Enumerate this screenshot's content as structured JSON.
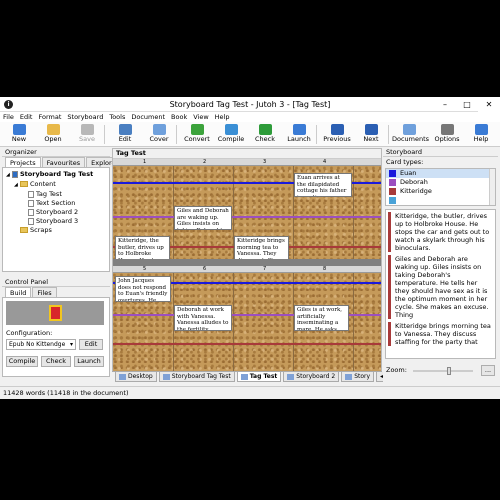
{
  "window": {
    "title": "Storyboard Tag Test - Jutoh 3 - [Tag Test]",
    "app_icon": "info-icon"
  },
  "menu": [
    "File",
    "Edit",
    "Format",
    "Storyboard",
    "Tools",
    "Document",
    "Book",
    "View",
    "Help"
  ],
  "toolbar": [
    {
      "label": "New",
      "icon": "new-document-icon",
      "color": "#3a7bd5",
      "enabled": true
    },
    {
      "label": "Open",
      "icon": "open-folder-icon",
      "color": "#e8b94a",
      "enabled": true
    },
    {
      "label": "Save",
      "icon": "floppy-disk-icon",
      "color": "#555555",
      "enabled": false
    },
    {
      "label": "Edit",
      "icon": "edit-icon",
      "color": "#4a7fc1",
      "enabled": true
    },
    {
      "label": "Cover",
      "icon": "cover-icon",
      "color": "#6fa0dc",
      "enabled": true
    },
    {
      "label": "Convert",
      "icon": "convert-icon",
      "color": "#3ca33c",
      "enabled": true
    },
    {
      "label": "Compile",
      "icon": "compile-icon",
      "color": "#3a8fd5",
      "enabled": true
    },
    {
      "label": "Check",
      "icon": "check-icon",
      "color": "#2e9c3a",
      "enabled": true
    },
    {
      "label": "Launch",
      "icon": "launch-icon",
      "color": "#3a7bd5",
      "enabled": true
    },
    {
      "label": "Previous",
      "icon": "previous-icon",
      "color": "#2b5fb3",
      "enabled": true
    },
    {
      "label": "Next",
      "icon": "next-icon",
      "color": "#2b5fb3",
      "enabled": true
    },
    {
      "label": "Documents",
      "icon": "documents-icon",
      "color": "#6fa0dc",
      "enabled": true
    },
    {
      "label": "Options",
      "icon": "options-icon",
      "color": "#777777",
      "enabled": true
    },
    {
      "label": "Help",
      "icon": "help-icon",
      "color": "#3a7bd5",
      "enabled": true
    }
  ],
  "organizer": {
    "title": "Organizer",
    "tabs": [
      "Projects",
      "Favourites",
      "Explorer"
    ],
    "tree": [
      {
        "label": "Storyboard Tag Test",
        "type": "root"
      },
      {
        "label": "Content",
        "type": "folder"
      },
      {
        "label": "Tag Test",
        "type": "doc"
      },
      {
        "label": "Text Section",
        "type": "doc"
      },
      {
        "label": "Storyboard 2",
        "type": "doc"
      },
      {
        "label": "Storyboard 3",
        "type": "doc"
      },
      {
        "label": "Scraps",
        "type": "folder"
      }
    ]
  },
  "control_panel": {
    "title": "Control Panel",
    "tabs": [
      "Build",
      "Files"
    ],
    "config_label": "Configuration:",
    "config_value": "Epub No Kittendge",
    "edit": "Edit",
    "compile": "Compile",
    "check": "Check",
    "launch": "Launch"
  },
  "storyboard": {
    "title": "Tag Test",
    "columns_top": [
      "1",
      "2",
      "3",
      "4"
    ],
    "columns_bottom": [
      "5",
      "6",
      "7",
      "8"
    ],
    "cards_top": [
      "Euan arrives at the dilapidated cottage his father is renting.",
      "Giles and Deborah are waking up. Giles insists on taking Deborah's",
      "Kitteridge, the butler, drives up to Holbroke House. He stops the car and gets out",
      "Kitteridge brings morning tea to Vanessa. They discuss staffing for the party."
    ],
    "cards_bottom": [
      "John Jacques does not respond to Euan's friendly overtures. He does let him come",
      "Deborah at work with Vanessa. Vanessa alludes to the fertility treatment - Deborah is",
      "Giles is at work, artificially inseminating a mare. He asks his"
    ]
  },
  "bottom_tabs": [
    "Desktop",
    "Storyboard Tag Test",
    "Tag Test",
    "Storyboard 2",
    "Story"
  ],
  "right_panel": {
    "title": "Storyboard",
    "card_types_label": "Card types:",
    "card_types": [
      {
        "name": "Euan",
        "color": "#1a1adc"
      },
      {
        "name": "Deborah",
        "color": "#9c4fbf"
      },
      {
        "name": "Kitteridge",
        "color": "#a83a3a"
      },
      {
        "name": "",
        "color": "#4aa3d8"
      }
    ],
    "notes": [
      "Kitteridge, the butler, drives up to Holbroke House. He stops the car and gets out to watch a skylark through his binoculars.",
      "Giles and Deborah are waking up. Giles insists on taking Deborah's temperature. He tells her they should have sex as it is the optimum moment in her cycle. She makes an excuse. Thing",
      "Kitteridge brings morning tea to Vanessa. They discuss staffing for the party that"
    ],
    "zoom_label": "Zoom:",
    "zoom_btn": "..."
  },
  "status": "11428 words (11418 in the document)"
}
